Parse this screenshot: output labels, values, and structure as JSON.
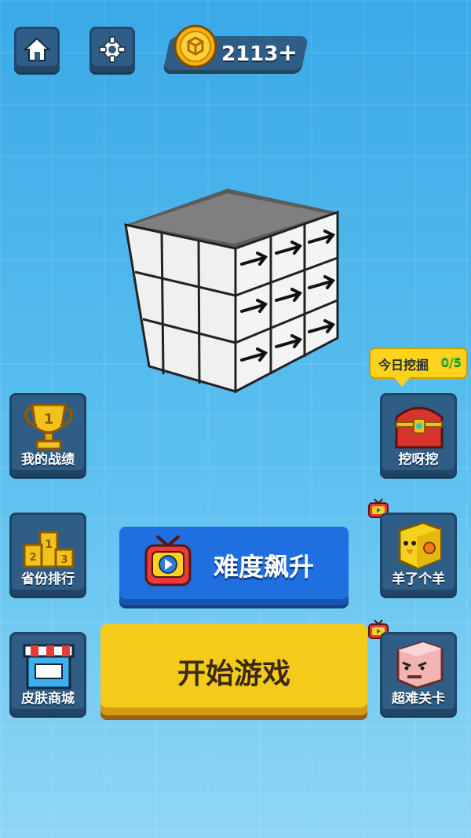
{
  "top_bar": {
    "home_icon": "home-icon",
    "settings_icon": "gear-icon",
    "coin_icon": "gold-coin-icon",
    "coins": "2113",
    "add_label": "+"
  },
  "hero": {
    "cube_icon": "arrow-cube-icon"
  },
  "left_menu": {
    "stats_label": "我的战绩",
    "ranking_label": "省份排行",
    "shop_label": "皮肤商城"
  },
  "right_menu": {
    "dig_bubble_label": "今日挖掘",
    "dig_bubble_count": "0/5",
    "dig_label": "挖呀挖",
    "sheep_label": "羊了个羊",
    "hard_label": "超难关卡"
  },
  "main_buttons": {
    "difficulty_label": "难度飙升",
    "start_label": "开始游戏"
  },
  "colors": {
    "accent_blue": "#1f6fe0",
    "accent_yellow": "#f4cb1a",
    "panel": "#2f5d86"
  }
}
